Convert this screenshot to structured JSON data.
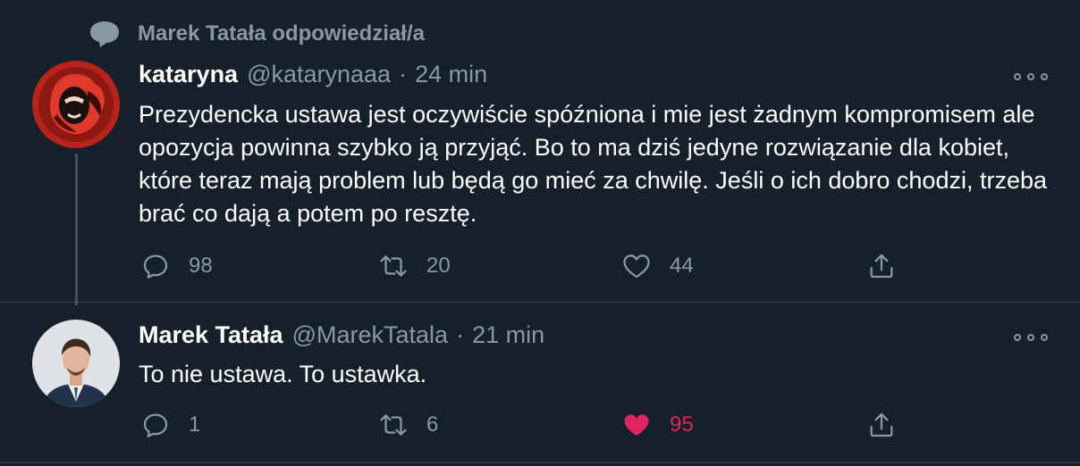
{
  "context": {
    "text": "Marek Tatała odpowiedział/a",
    "icon": "speech-bubble-icon"
  },
  "tweets": [
    {
      "name": "kataryna",
      "handle": "@katarynaaa",
      "separator": "·",
      "time": "24 min",
      "text": "Prezydencka ustawa jest oczywiście spóźniona i mie jest żadnym kompromisem ale opozycja powinna szybko ją przyjąć. Bo to ma dziś jedyne rozwiązanie dla kobiet, które teraz mają problem lub będą go mieć za chwilę. Jeśli o ich dobro chodzi, trzeba brać co dają a potem po resztę.",
      "stats": {
        "replies": "98",
        "retweets": "20",
        "likes": "44"
      },
      "liked": false
    },
    {
      "name": "Marek Tatała",
      "handle": "@MarekTatala",
      "separator": "·",
      "time": "21 min",
      "text": "To nie ustawa. To ustawka.",
      "stats": {
        "replies": "1",
        "retweets": "6",
        "likes": "95"
      },
      "liked": true
    }
  ],
  "colors": {
    "background": "#15202b",
    "secondary_text": "#8899a6",
    "like_active": "#e0245e",
    "separator": "#38444d"
  }
}
